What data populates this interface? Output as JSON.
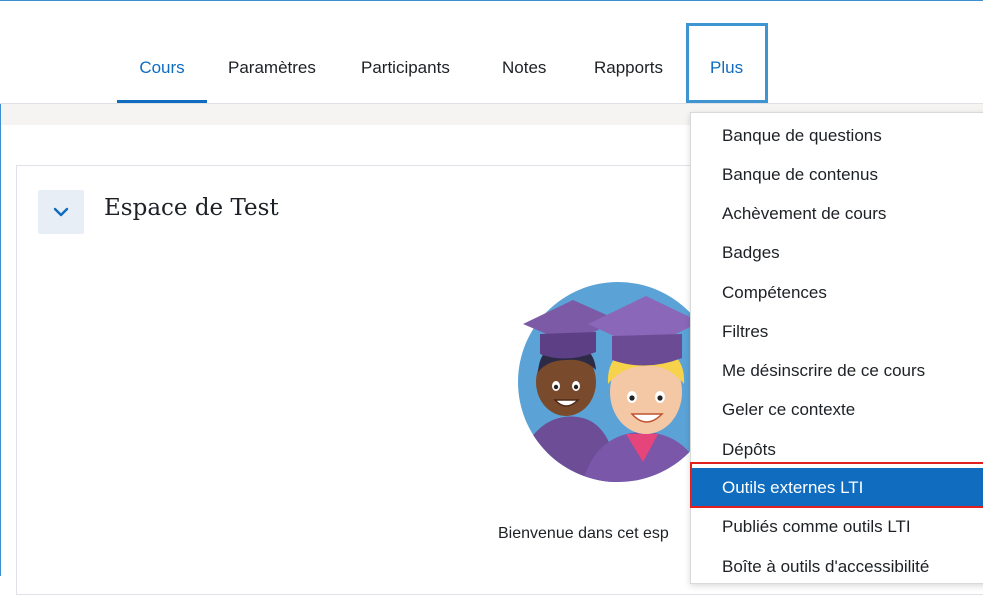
{
  "nav": {
    "tabs": [
      {
        "label": "Cours"
      },
      {
        "label": "Paramètres"
      },
      {
        "label": "Participants"
      },
      {
        "label": "Notes"
      },
      {
        "label": "Rapports"
      },
      {
        "label": "Plus"
      }
    ]
  },
  "section": {
    "title": "Espace de Test",
    "welcome_text": "Bienvenue dans cet esp"
  },
  "menu": {
    "items": [
      {
        "label": "Banque de questions"
      },
      {
        "label": "Banque de contenus"
      },
      {
        "label": "Achèvement de cours"
      },
      {
        "label": "Badges"
      },
      {
        "label": "Compétences"
      },
      {
        "label": "Filtres"
      },
      {
        "label": "Me désinscrire de ce cours"
      },
      {
        "label": "Geler ce contexte"
      },
      {
        "label": "Dépôts"
      },
      {
        "label": "Outils externes LTI"
      },
      {
        "label": "Publiés comme outils LTI"
      },
      {
        "label": "Boîte à outils d'accessibilité"
      }
    ],
    "highlighted_index": 9
  },
  "colors": {
    "primary": "#0f6cbf",
    "highlight_outline": "#e1201f",
    "focus_outline": "#3f94d2"
  },
  "icons": {
    "collapse": "chevron-down-icon",
    "illustration": "graduates-illustration"
  }
}
